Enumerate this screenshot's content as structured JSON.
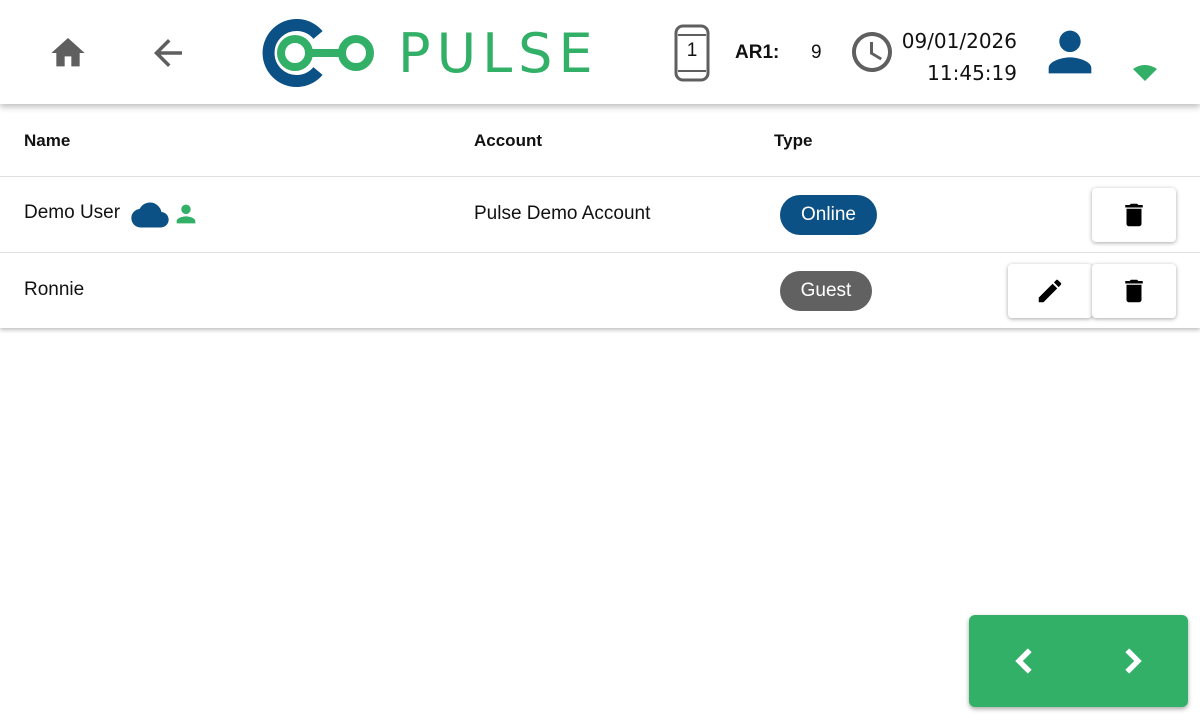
{
  "header": {
    "logo_text": "PULSE",
    "device_number": "1",
    "ar_label": "AR1:",
    "ar_value": "9",
    "date": "09/01/2026",
    "time": "11:45:19",
    "icons": [
      "home-icon",
      "back-arrow-icon",
      "phone-device-icon",
      "clock-icon",
      "user-icon",
      "wifi-icon"
    ],
    "colors": {
      "brand_blue": "#0b5185",
      "brand_green": "#33b067",
      "icon_grey": "#5f5f5f"
    }
  },
  "table": {
    "columns": [
      "Name",
      "Account",
      "Type"
    ],
    "rows": [
      {
        "name": "Demo User",
        "account": "Pulse Demo Account",
        "type": "Online",
        "type_color": "#0b5185",
        "icons": [
          "cloud-icon",
          "person-icon"
        ],
        "actions": [
          "delete"
        ]
      },
      {
        "name": "Ronnie",
        "account": "",
        "type": "Guest",
        "type_color": "#616161",
        "icons": [],
        "actions": [
          "edit",
          "delete"
        ]
      }
    ]
  },
  "pager": {
    "icons": [
      "chevron-left-icon",
      "chevron-right-icon"
    ]
  }
}
